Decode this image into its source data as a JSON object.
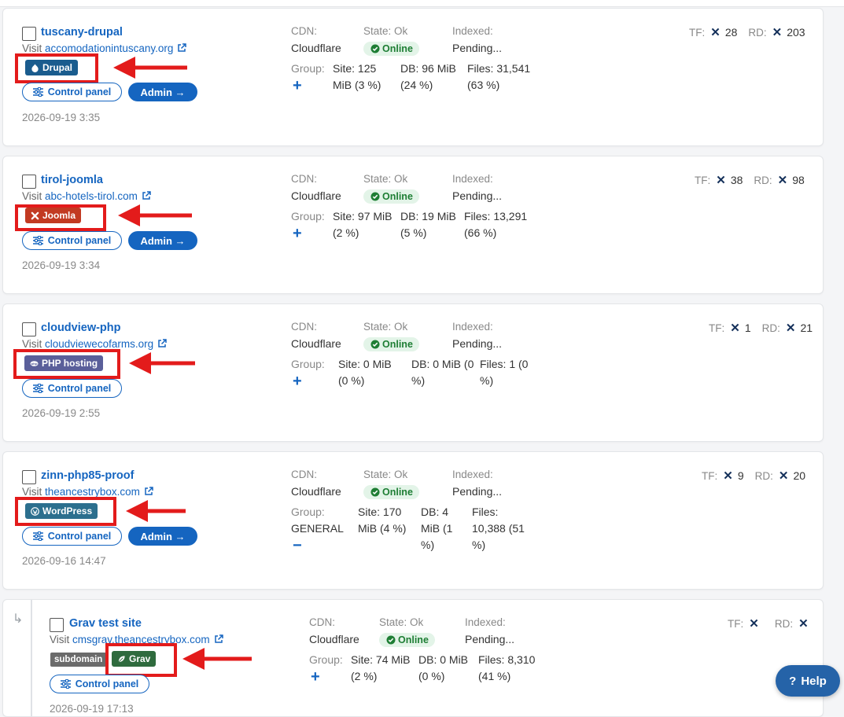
{
  "labels": {
    "visit": "Visit",
    "cdn": "CDN:",
    "state": "State: Ok",
    "indexed": "Indexed:",
    "pending": "Pending...",
    "online": "Online",
    "control_panel": "Control panel",
    "admin": "Admin →",
    "tf": "TF:",
    "rd": "RD:",
    "help": "Help",
    "subdomain": "subdomain"
  },
  "colors": {
    "drupal": "#1a5c8e",
    "joomla": "#c23a22",
    "php": "#5a5f9a",
    "wordpress": "#2c6f8e",
    "grav": "#2f6b3e",
    "highlight": "#e31b1b",
    "primary": "#1565c0"
  },
  "sites": [
    {
      "name": "tuscany-drupal",
      "url": "accomodationintuscany.org",
      "badge": "Drupal",
      "badge_icon": "drupal-icon",
      "cdn": "Cloudflare",
      "group_l1": "Group:",
      "group_l2": "+",
      "site_l1": "Site: 125",
      "site_l2": "MiB (3 %)",
      "db_l1": "DB: 96 MiB",
      "db_l2": "(24 %)",
      "files_l1": "Files: 31,541",
      "files_l2": "(63 %)",
      "tf": "28",
      "rd": "203",
      "date": "2026-09-19 3:35",
      "has_admin": true
    },
    {
      "name": "tirol-joomla",
      "url": "abc-hotels-tirol.com",
      "badge": "Joomla",
      "badge_icon": "joomla-icon",
      "cdn": "Cloudflare",
      "group_l1": "Group:",
      "group_l2": "+",
      "site_l1": "Site: 97 MiB",
      "site_l2": "(2 %)",
      "db_l1": "DB: 19 MiB",
      "db_l2": "(5 %)",
      "files_l1": "Files: 13,291",
      "files_l2": "(66 %)",
      "tf": "38",
      "rd": "98",
      "date": "2026-09-19 3:34",
      "has_admin": true
    },
    {
      "name": "cloudview-php",
      "url": "cloudviewecofarms.org",
      "badge": "PHP hosting",
      "badge_icon": "php-icon",
      "cdn": "Cloudflare",
      "group_l1": "Group:",
      "group_l2": "+",
      "site_l1": "Site: 0 MiB",
      "site_l2": "(0 %)",
      "db_l1": "DB: 0 MiB (0",
      "db_l2": "%)",
      "files_l1": "Files: 1 (0",
      "files_l2": "%)",
      "tf": "1",
      "rd": "21",
      "date": "2026-09-19 2:55",
      "has_admin": false
    },
    {
      "name": "zinn-php85-proof",
      "url": "theancestrybox.com",
      "badge": "WordPress",
      "badge_icon": "wordpress-icon",
      "cdn": "Cloudflare",
      "group_l1": "Group:",
      "group_l2": "GENERAL",
      "group_l3": "−",
      "site_l1": "Site: 170",
      "site_l2": "MiB (4 %)",
      "db_l1": "DB: 4",
      "db_l2": "MiB (1",
      "db_l3": "%)",
      "files_l1": "Files:",
      "files_l2": "10,388 (51",
      "files_l3": "%)",
      "tf": "9",
      "rd": "20",
      "date": "2026-09-16 14:47",
      "has_admin": true
    },
    {
      "name": "Grav test site",
      "url": "cmsgrav.theancestrybox.com",
      "badge": "Grav",
      "badge_icon": "grav-icon",
      "cdn": "Cloudflare",
      "group_l1": "Group:",
      "group_l2": "+",
      "site_l1": "Site: 74 MiB",
      "site_l2": "(2 %)",
      "db_l1": "DB: 0 MiB",
      "db_l2": "(0 %)",
      "files_l1": "Files: 8,310",
      "files_l2": "(41 %)",
      "tf": "",
      "rd": "",
      "date": "2026-09-19 17:13",
      "has_admin": false
    }
  ]
}
